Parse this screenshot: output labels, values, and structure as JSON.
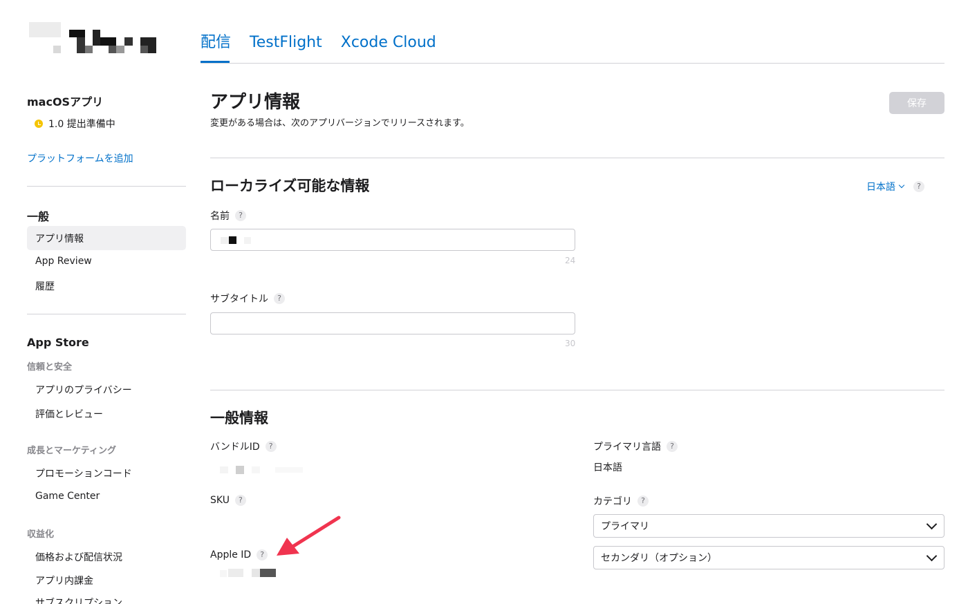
{
  "nav": {
    "tabs": [
      {
        "label": "配信",
        "active": true
      },
      {
        "label": "TestFlight",
        "active": false
      },
      {
        "label": "Xcode Cloud",
        "active": false
      }
    ]
  },
  "sidebar": {
    "app_title": "macOSアプリ",
    "status": "1.0 提出準備中",
    "add_platform": "プラットフォームを追加",
    "general": {
      "title": "一般",
      "items": [
        "アプリ情報",
        "App Review",
        "履歴"
      ]
    },
    "app_store": {
      "title": "App Store",
      "groups": [
        {
          "title": "信頼と安全",
          "items": [
            "アプリのプライバシー",
            "評価とレビュー"
          ]
        },
        {
          "title": "成長とマーケティング",
          "items": [
            "プロモーションコード",
            "Game Center"
          ]
        },
        {
          "title": "収益化",
          "items": [
            "価格および配信状況",
            "アプリ内課金",
            "サブスクリプション"
          ]
        }
      ]
    }
  },
  "main": {
    "title": "アプリ情報",
    "description": "変更がある場合は、次のアプリバージョンでリリースされます。",
    "save_label": "保存",
    "localizable": {
      "title": "ローカライズ可能な情報",
      "language": "日本語",
      "name_label": "名前",
      "name_counter": "24",
      "subtitle_label": "サブタイトル",
      "subtitle_counter": "30"
    },
    "general_info": {
      "title": "一般情報",
      "bundle_id_label": "バンドルID",
      "sku_label": "SKU",
      "apple_id_label": "Apple ID",
      "primary_language_label": "プライマリ言語",
      "primary_language_value": "日本語",
      "category_label": "カテゴリ",
      "primary_category": "プライマリ",
      "secondary_category": "セカンダリ（オプション）"
    },
    "question_mark": "?"
  },
  "colors": {
    "accent": "#0070c9",
    "arrow": "#f0344f",
    "status_dot": "#f5c400"
  }
}
